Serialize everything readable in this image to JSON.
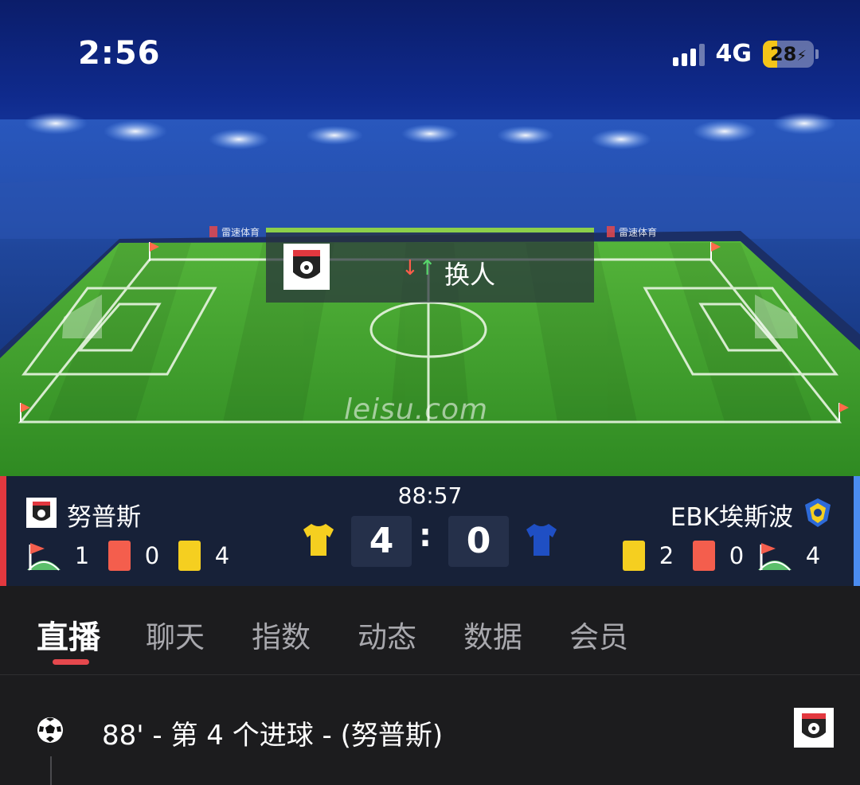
{
  "status_bar": {
    "time": "2:56",
    "network": "4G",
    "battery": "28",
    "battery_level": 0.28
  },
  "event_popup": {
    "text": "换人",
    "icon": "substitution-arrows-icon"
  },
  "pitch": {
    "watermark": "leisu.com",
    "ad_board": "雷速体育"
  },
  "match": {
    "clock": "88:57",
    "home": {
      "name": "努普斯",
      "corners": "1",
      "red_cards": "0",
      "yellow_cards": "4",
      "score": "4",
      "shirt_color": "#f5cf20"
    },
    "away": {
      "name": "EBK埃斯波",
      "yellow_cards": "2",
      "red_cards": "0",
      "corners": "4",
      "score": "0",
      "shirt_color": "#1f4fc4"
    },
    "separator": ":"
  },
  "tabs": [
    {
      "label": "直播",
      "active": true
    },
    {
      "label": "聊天"
    },
    {
      "label": "指数"
    },
    {
      "label": "动态"
    },
    {
      "label": "数据"
    },
    {
      "label": "会员"
    }
  ],
  "feed": [
    {
      "text": "88' - 第 4 个进球 - (努普斯)",
      "icon": "soccer-ball-icon"
    }
  ],
  "colors": {
    "home_accent": "#e2383f",
    "away_accent": "#4b8cf0",
    "tab_underline": "#e5484d",
    "pitch": "#3f9a2c"
  }
}
